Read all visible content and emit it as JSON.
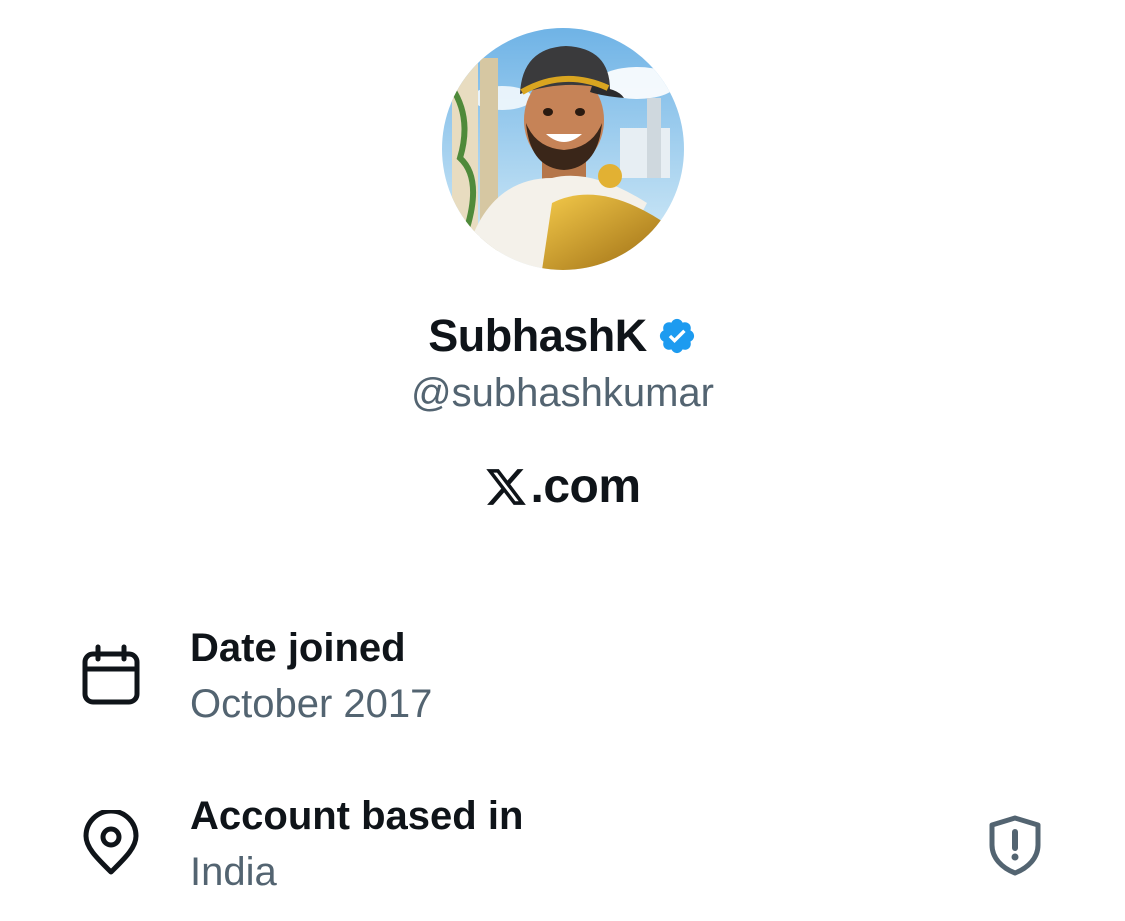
{
  "profile": {
    "display_name": "SubhashK",
    "handle": "@subhashkumar",
    "verified_icon": "verified-badge-icon",
    "avatar_icon": "profile-avatar",
    "brand_logo_icon": "x-logo-icon",
    "brand_text": ".com"
  },
  "details": {
    "date_joined": {
      "icon": "calendar-icon",
      "label": "Date joined",
      "value": "October 2017"
    },
    "account_based_in": {
      "icon": "location-pin-icon",
      "label": "Account based in",
      "value": "India",
      "action_icon": "shield-alert-icon"
    }
  },
  "colors": {
    "primary_text": "#0f1419",
    "secondary_text": "#536471",
    "verified_blue": "#1d9bf0",
    "background": "#ffffff"
  }
}
